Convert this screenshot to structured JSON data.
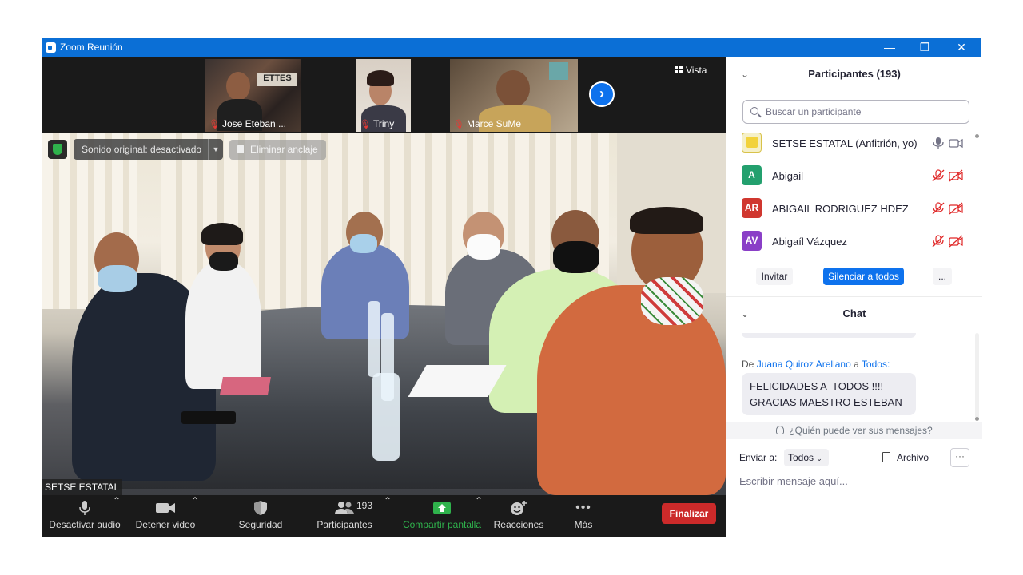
{
  "window": {
    "title": "Zoom Reunión"
  },
  "filmstrip": {
    "thumbnails": [
      {
        "name": "Jose Eteban ..."
      },
      {
        "name": "Triny"
      },
      {
        "name": "Marce SuMe"
      }
    ],
    "view_label": "Vista"
  },
  "main_video": {
    "audio_option": "Sonido original: desactivado",
    "unpin_label": "Eliminar anclaje",
    "participant_label": "SETSE ESTATAL"
  },
  "toolbar": {
    "mute": "Desactivar audio",
    "video": "Detener video",
    "security": "Seguridad",
    "participants": "Participantes",
    "participants_count": "193",
    "share": "Compartir pantalla",
    "reactions": "Reacciones",
    "more": "Más",
    "end": "Finalizar"
  },
  "participants_panel": {
    "title": "Participantes (193)",
    "search_placeholder": "Buscar un participante",
    "list": [
      {
        "name": "SETSE ESTATAL (Anfitrión, yo)",
        "initials": "",
        "color": "#f2d23a"
      },
      {
        "name": "Abigail",
        "initials": "A",
        "color": "#23a06e"
      },
      {
        "name": "ABIGAIL RODRIGUEZ HDEZ",
        "initials": "AR",
        "color": "#d0372f"
      },
      {
        "name": "Abigaíl Vázquez",
        "initials": "AV",
        "color": "#8a3fc7"
      }
    ],
    "invite": "Invitar",
    "mute_all": "Silenciar a todos",
    "more": "..."
  },
  "chat_panel": {
    "title": "Chat",
    "from_prefix": "De",
    "sender": "Juana Quiroz Arellano",
    "to_word": "a",
    "recipient": "Todos:",
    "message": "FELICIDADES A  TODOS !!!!\nGRACIAS MAESTRO ESTEBAN",
    "who_can_see": "¿Quién puede ver sus mensajes?",
    "send_to_label": "Enviar a:",
    "send_to_value": "Todos",
    "file_label": "Archivo",
    "more": "···",
    "input_placeholder": "Escribir mensaje aquí..."
  },
  "colors": {
    "titlebar": "#0b6fd6",
    "accent": "#0e72ed",
    "end_button": "#cc2a2a",
    "share_green": "#2fb24c",
    "muted_red": "#e53935"
  }
}
